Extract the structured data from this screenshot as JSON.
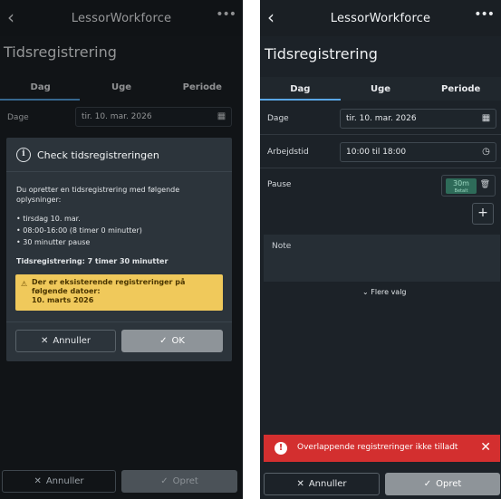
{
  "left": {
    "app_title": "LessorWorkforce",
    "page_title": "Tidsregistrering",
    "tabs": [
      "Dag",
      "Uge",
      "Periode"
    ],
    "date_label": "Dage",
    "date_value": "tir. 10. mar. 2026",
    "dialog": {
      "title": "Check tidsregistreringen",
      "intro": "Du opretter en tidsregistrering med følgende oplysninger:",
      "line1": "• tirsdag 10. mar.",
      "line2": "• 08:00-16:00 (8 timer 0 minutter)",
      "line3": "• 30 minutter pause",
      "summary": "Tidsregistrering: 7 timer 30 minutter",
      "warning_line1": "Der er eksisterende registreringer på følgende datoer:",
      "warning_line2": "10. marts 2026",
      "cancel": "Annuller",
      "ok": "OK"
    },
    "footer": {
      "cancel": "Annuller",
      "create": "Opret"
    }
  },
  "right": {
    "app_title": "LessorWorkforce",
    "page_title": "Tidsregistrering",
    "tabs": [
      "Dag",
      "Uge",
      "Periode"
    ],
    "date_label": "Dage",
    "date_value": "tir. 10. mar. 2026",
    "work_label": "Arbejdstid",
    "work_value": "10:00 til 18:00",
    "pause_label": "Pause",
    "pause_value": "30m",
    "pause_sub": "Betalt",
    "note_label": "Note",
    "more_options": "Flere valg",
    "toast": "Overlappende registreringer ikke tilladt",
    "footer": {
      "cancel": "Annuller",
      "create": "Opret"
    }
  },
  "colors": {
    "accent": "#5aa7e6",
    "warning": "#f0c95b",
    "error": "#d32f2f",
    "background": "#1c2126"
  }
}
